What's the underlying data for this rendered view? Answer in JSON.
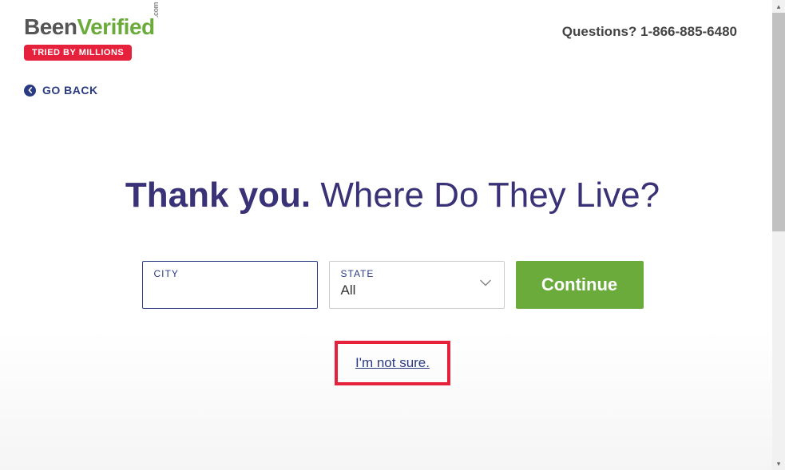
{
  "header": {
    "logo": {
      "part1": "Been",
      "part2": "Verified",
      "suffix": ".com"
    },
    "badge": "TRIED BY MILLIONS",
    "questions": "Questions? 1-866-885-6480"
  },
  "nav": {
    "goback": "GO BACK"
  },
  "main": {
    "heading_bold": "Thank you.",
    "heading_rest": " Where Do They Live?"
  },
  "form": {
    "city_label": "CITY",
    "city_value": "",
    "state_label": "STATE",
    "state_value": "All",
    "continue_label": "Continue"
  },
  "notsure": {
    "label": "I'm not sure."
  }
}
